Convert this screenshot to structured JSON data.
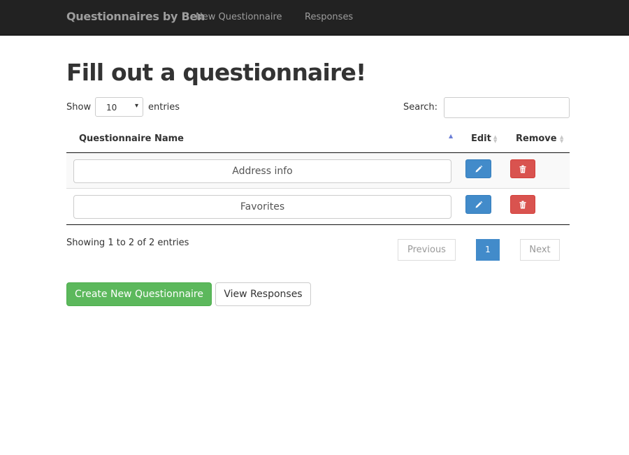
{
  "navbar": {
    "brand": "Questionnaires by Ben",
    "links": [
      "New Questionnaire",
      "Responses"
    ]
  },
  "page": {
    "title": "Fill out a questionnaire!"
  },
  "table_controls": {
    "show_label": "Show",
    "page_length": "10",
    "entries_label": "entries",
    "search_label": "Search:",
    "search_value": ""
  },
  "table": {
    "headers": [
      "Questionnaire Name",
      "Edit",
      "Remove"
    ],
    "rows": [
      {
        "name": "Address info",
        "edit_icon": "pencil-icon",
        "remove_icon": "trash-icon"
      },
      {
        "name": "Favorites",
        "edit_icon": "pencil-icon",
        "remove_icon": "trash-icon"
      }
    ]
  },
  "footer": {
    "info": "Showing 1 to 2 of 2 entries",
    "pagination": {
      "previous": "Previous",
      "current": "1",
      "next": "Next"
    }
  },
  "actions": {
    "create": "Create New Questionnaire",
    "view": "View Responses"
  },
  "colors": {
    "navbar_bg": "#222222",
    "primary": "#428bca",
    "danger": "#d9534f",
    "success": "#5cb85c"
  }
}
